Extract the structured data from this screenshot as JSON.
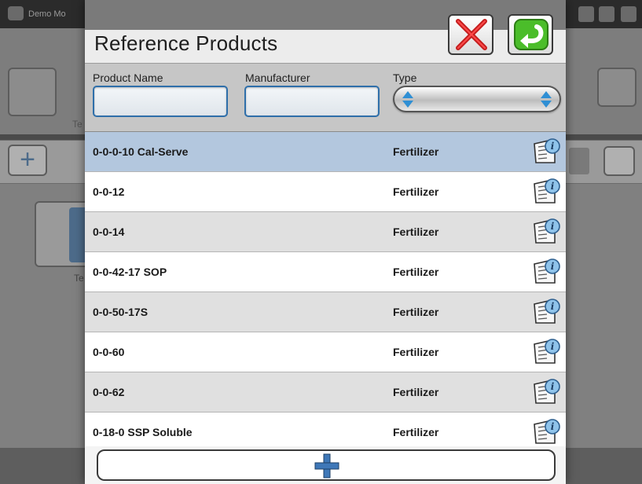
{
  "background": {
    "topbar_text": "Demo Mo",
    "label_left": "Te",
    "label_card": "Te"
  },
  "dialog": {
    "title": "Reference Products",
    "cancel_icon": "red-x-icon",
    "ok_icon": "green-return-arrow-icon",
    "add_icon": "plus-icon",
    "accent": "#2f6faa",
    "selected_row_color": "#b3c7de"
  },
  "filters": {
    "product_name_label": "Product Name",
    "manufacturer_label": "Manufacturer",
    "type_label": "Type",
    "product_name_value": "",
    "manufacturer_value": "",
    "type_value": ""
  },
  "products": [
    {
      "name": "0-0-0-10 Cal-Serve",
      "type": "Fertilizer",
      "selected": true
    },
    {
      "name": "0-0-12",
      "type": "Fertilizer",
      "selected": false
    },
    {
      "name": "0-0-14",
      "type": "Fertilizer",
      "selected": false
    },
    {
      "name": "0-0-42-17 SOP",
      "type": "Fertilizer",
      "selected": false
    },
    {
      "name": "0-0-50-17S",
      "type": "Fertilizer",
      "selected": false
    },
    {
      "name": "0-0-60",
      "type": "Fertilizer",
      "selected": false
    },
    {
      "name": "0-0-62",
      "type": "Fertilizer",
      "selected": false
    },
    {
      "name": "0-18-0 SSP Soluble",
      "type": "Fertilizer",
      "selected": false
    }
  ]
}
